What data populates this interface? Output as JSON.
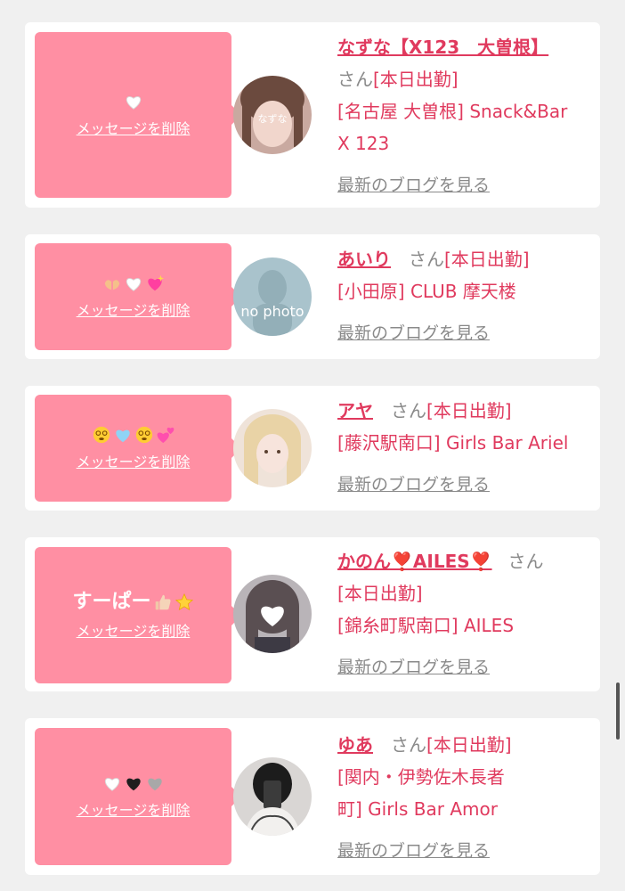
{
  "cards": [
    {
      "name": "なずな【X123　大曽根】",
      "san": "さん",
      "status": "[本日出勤]",
      "shop_line1": "[名古屋 大曽根] Snack&Bar",
      "shop_line2": "X 123",
      "blog": "最新のブログを見る",
      "delete": "メッセージを削除",
      "message_icons": [
        "white-heart"
      ],
      "avatar_text": "なずな"
    },
    {
      "name": "あいり",
      "san": "さん",
      "status": "[本日出勤]",
      "shop_line1": "[小田原] CLUB 摩天楼",
      "blog": "最新のブログを見る",
      "delete": "メッセージを削除",
      "message_icons": [
        "heart-hands",
        "white-heart",
        "sparkling-heart"
      ],
      "avatar_text": "no photo"
    },
    {
      "name": "アヤ",
      "san": "さん",
      "status": "[本日出勤]",
      "shop_line1": "[藤沢駅南口] Girls Bar Ariel",
      "blog": "最新のブログを見る",
      "delete": "メッセージを削除",
      "message_icons": [
        "dizzy-face",
        "light-blue-heart",
        "dizzy-face",
        "two-hearts"
      ]
    },
    {
      "name": "かのん❣️AILES❣️",
      "san": "さん",
      "status": "[本日出勤]",
      "shop_line1": "[錦糸町駅南口] AILES",
      "blog": "最新のブログを見る",
      "delete": "メッセージを削除",
      "message_text": "すーぱー",
      "message_icons": [
        "thumbs-up",
        "star"
      ]
    },
    {
      "name": "ゆあ",
      "san": "さん",
      "status": "[本日出勤]",
      "shop_line1": "[関内・伊勢佐木長者",
      "shop_line2": "町] Girls Bar Amor",
      "blog": "最新のブログを見る",
      "delete": "メッセージを削除",
      "message_icons": [
        "white-heart",
        "black-heart",
        "grey-heart"
      ]
    }
  ],
  "colors": {
    "accent": "#e03a5e",
    "bubble": "#ff8fa3",
    "muted": "#8a8a8a",
    "background": "#f0f0f0"
  }
}
